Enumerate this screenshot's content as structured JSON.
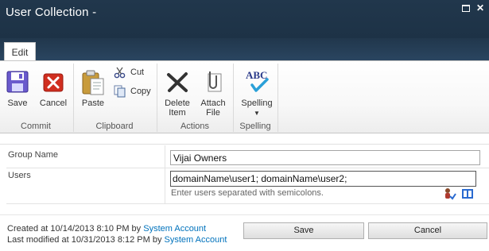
{
  "window": {
    "title": "User Collection -"
  },
  "tabs": [
    {
      "label": "Edit"
    }
  ],
  "ribbon": {
    "commit": {
      "label": "Commit",
      "save": "Save",
      "cancel": "Cancel"
    },
    "clipboard": {
      "label": "Clipboard",
      "paste": "Paste",
      "cut": "Cut",
      "copy": "Copy"
    },
    "actions": {
      "label": "Actions",
      "delete_line1": "Delete",
      "delete_line2": "Item",
      "attach_line1": "Attach",
      "attach_line2": "File"
    },
    "spelling": {
      "label": "Spelling",
      "button": "Spelling",
      "abc": "ABC"
    }
  },
  "form": {
    "group_name": {
      "label": "Group Name",
      "value": "Vijai Owners"
    },
    "users": {
      "label": "Users",
      "value": "domainName\\user1; domainName\\user2;",
      "hint": "Enter users separated with semicolons."
    }
  },
  "meta": {
    "created_prefix": "Created at 10/14/2013 8:10 PM  by",
    "created_by": "System Account",
    "modified_prefix": "Last modified at 10/31/2013 8:12 PM  by",
    "modified_by": "System Account"
  },
  "buttons": {
    "save": "Save",
    "cancel": "Cancel"
  },
  "colors": {
    "titlebar": "#21374c",
    "link": "#0072bc",
    "cancel_red": "#d02e1f"
  }
}
